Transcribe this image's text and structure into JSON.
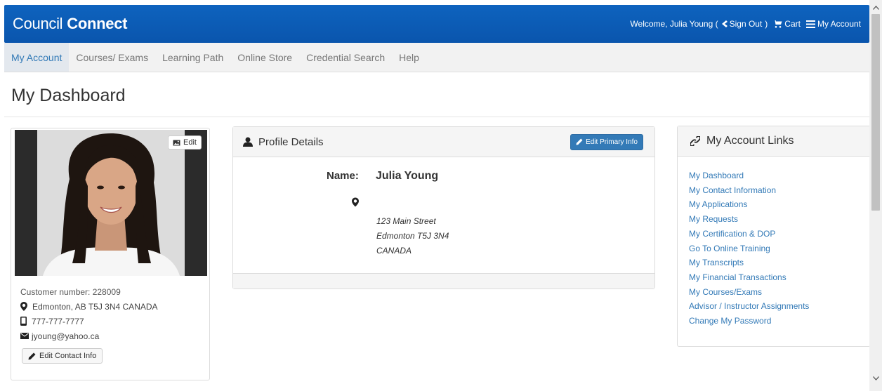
{
  "header": {
    "brand_part1": "Council",
    "brand_part2": "Connect",
    "welcome_prefix": "Welcome, Julia Young (",
    "sign_out": "Sign Out",
    "welcome_suffix": ")",
    "cart": "Cart",
    "my_account": "My Account",
    "bg_color": "#0a5cb8"
  },
  "nav": {
    "items": [
      "My Account",
      "Courses/ Exams",
      "Learning Path",
      "Online Store",
      "Credential Search",
      "Help"
    ],
    "active_index": 0
  },
  "page": {
    "title": "My Dashboard"
  },
  "profile_card": {
    "photo_edit": "Edit",
    "customer_number": "Customer number: 228009",
    "location": "Edmonton, AB T5J 3N4 CANADA",
    "phone": "777-777-7777",
    "email": "jyoung@yahoo.ca",
    "edit_contact": "Edit Contact Info"
  },
  "profile_details": {
    "title": "Profile Details",
    "edit_button": "Edit Primary Info",
    "name_label": "Name:",
    "name_value": "Julia Young",
    "address": [
      "123 Main Street",
      "Edmonton T5J 3N4",
      "CANADA"
    ]
  },
  "account_links": {
    "title": "My Account Links",
    "items": [
      "My Dashboard",
      "My Contact Information",
      "My Applications",
      "My Requests",
      "My Certification & DOP",
      "Go To Online Training",
      "My Transcripts",
      "My Financial Transactions",
      "My Courses/Exams",
      "Advisor / Instructor Assignments",
      "Change My Password"
    ]
  },
  "colors": {
    "link": "#337ab7",
    "primary": "#337ab7"
  }
}
